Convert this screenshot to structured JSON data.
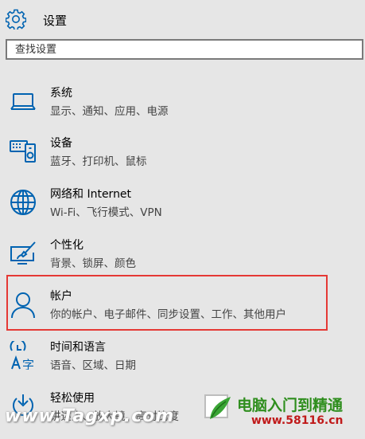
{
  "header": {
    "title": "设置",
    "icon": "gear-icon"
  },
  "search": {
    "placeholder": "查找设置"
  },
  "items": [
    {
      "name": "系统",
      "desc": "显示、通知、应用、电源",
      "icon": "laptop-icon"
    },
    {
      "name": "设备",
      "desc": "蓝牙、打印机、鼠标",
      "icon": "keyboard-speaker-icon"
    },
    {
      "name": "网络和 Internet",
      "desc": "Wi-Fi、飞行模式、VPN",
      "icon": "globe-icon"
    },
    {
      "name": "个性化",
      "desc": "背景、锁屏、颜色",
      "icon": "monitor-pen-icon"
    },
    {
      "name": "帐户",
      "desc": "你的帐户、电子邮件、同步设置、工作、其他用户",
      "icon": "person-icon"
    },
    {
      "name": "时间和语言",
      "desc": "语音、区域、日期",
      "icon": "clock-language-icon"
    },
    {
      "name": "轻松使用",
      "desc": "讲述人、放大镜、高对比度",
      "icon": "ease-of-access-icon"
    }
  ],
  "highlight_item": "帐户",
  "colors": {
    "accent": "#0063b1",
    "highlight_border": "#e53935",
    "background": "#e6e6e6"
  },
  "watermarks": {
    "left": "www.Tagxp.com",
    "right_cn": "电脑入门到精通",
    "right_url": "www.58116.cn"
  }
}
